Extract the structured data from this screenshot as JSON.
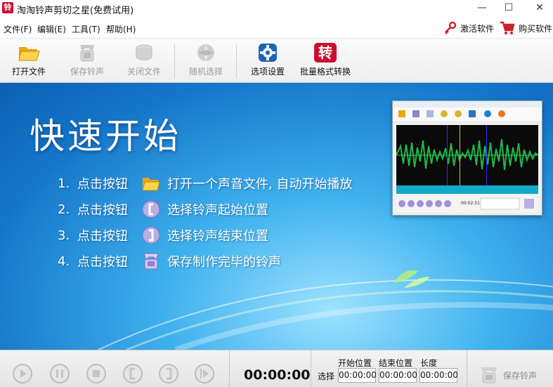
{
  "window": {
    "title": "淘淘铃声剪切之星(免费试用)",
    "icon_char": "铃",
    "minimize": "—",
    "maximize": "☐",
    "close": "✕"
  },
  "menu": {
    "items": [
      "文件(F)",
      "编辑(E)",
      "工具(T)",
      "帮助(H)"
    ],
    "activate_label": "激活软件",
    "buy_label": "购买软件"
  },
  "toolbar": {
    "open": "打开文件",
    "save": "保存铃声",
    "close": "关闭文件",
    "random": "随机选择",
    "options": "选项设置",
    "batch": "批量格式转换",
    "batch_icon_char": "转"
  },
  "banner": {
    "title": "快速开始",
    "steps": [
      {
        "num": "1.",
        "action": "点击按钮",
        "desc": "打开一个声音文件, 自动开始播放",
        "icon": "folder-icon"
      },
      {
        "num": "2.",
        "action": "点击按钮",
        "desc": "选择铃声起始位置",
        "icon": "start-bracket-icon"
      },
      {
        "num": "3.",
        "action": "点击按钮",
        "desc": "选择铃声结束位置",
        "icon": "end-bracket-icon"
      },
      {
        "num": "4.",
        "action": "点击按钮",
        "desc": "保存制作完毕的铃声",
        "icon": "save-ringtone-icon"
      }
    ],
    "preview_time": "00:02:51"
  },
  "controls": {
    "time": "00:00:00",
    "headers": {
      "start": "开始位置",
      "end": "结束位置",
      "length": "长度"
    },
    "select_label": "选择",
    "start_value": "00:00:00",
    "end_value": "00:00:00",
    "length_value": "00:00:00",
    "save_label": "保存铃声"
  },
  "colors": {
    "banner_dark": "#0c5fb3",
    "banner_light": "#9fe2ff",
    "icon_red": "#c8102e",
    "disabled_text": "#9a9a9a"
  }
}
